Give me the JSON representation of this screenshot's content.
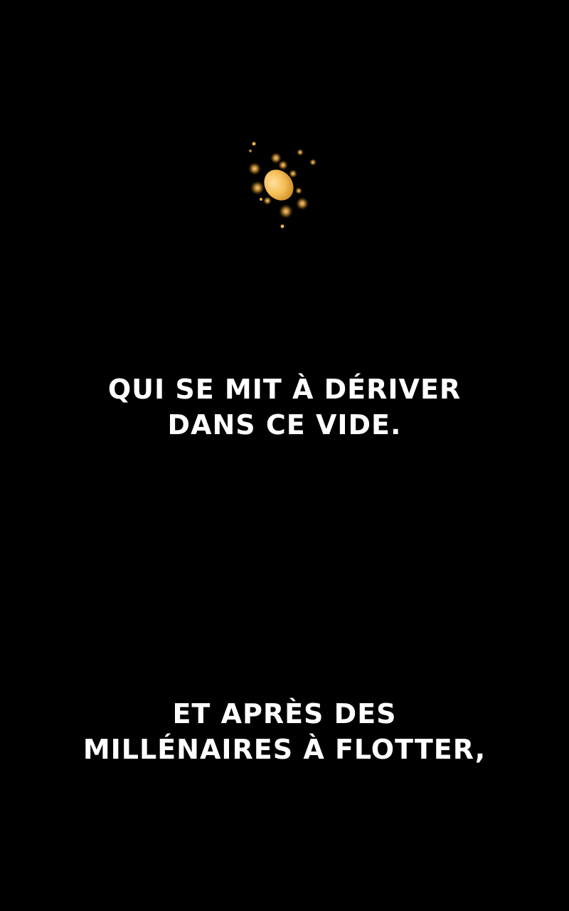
{
  "page": {
    "background_color": "#000000"
  },
  "illustration": {
    "subject": "glowing-golden-orb-with-sparkles",
    "orb_color": "#f6c15c",
    "glow_color": "#d89a2e"
  },
  "captions": [
    {
      "lines": [
        "QUI SE MIT À DÉRIVER",
        "DANS CE VIDE."
      ]
    },
    {
      "lines": [
        "ET APRÈS DES",
        "MILLÉNAIRES À FLOTTER,"
      ]
    }
  ],
  "text_color": "#ffffff"
}
